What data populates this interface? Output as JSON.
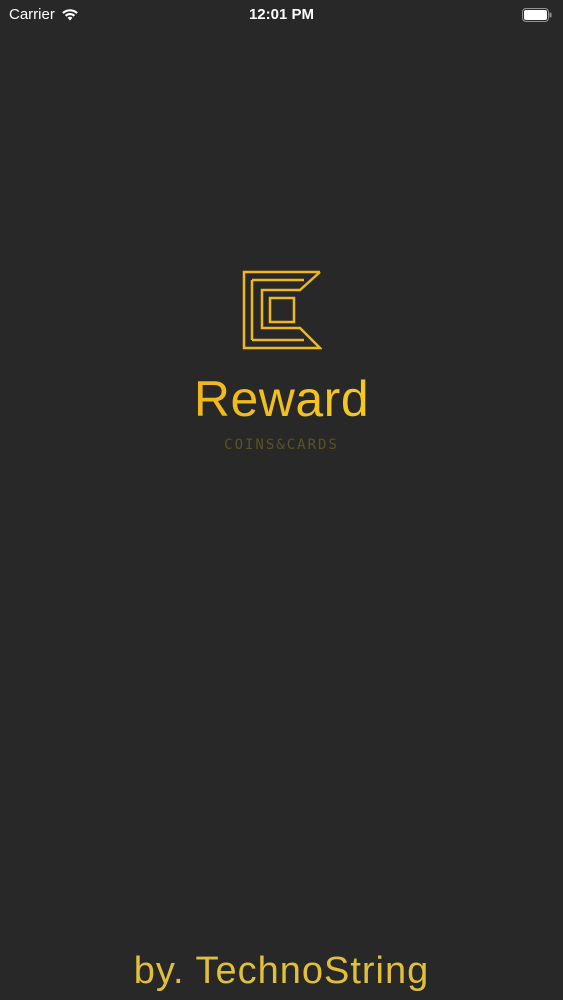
{
  "status_bar": {
    "carrier": "Carrier",
    "time": "12:01 PM",
    "wifi_icon": "wifi-icon",
    "battery_icon": "battery-icon"
  },
  "splash": {
    "logo_icon": "cc-logo-icon",
    "app_name": "Reward",
    "tagline": "COINS&CARDS",
    "credit": "by. TechnoString"
  },
  "colors": {
    "background": "#282828",
    "accent": "#f3c31f",
    "tagline": "#5b5322"
  }
}
